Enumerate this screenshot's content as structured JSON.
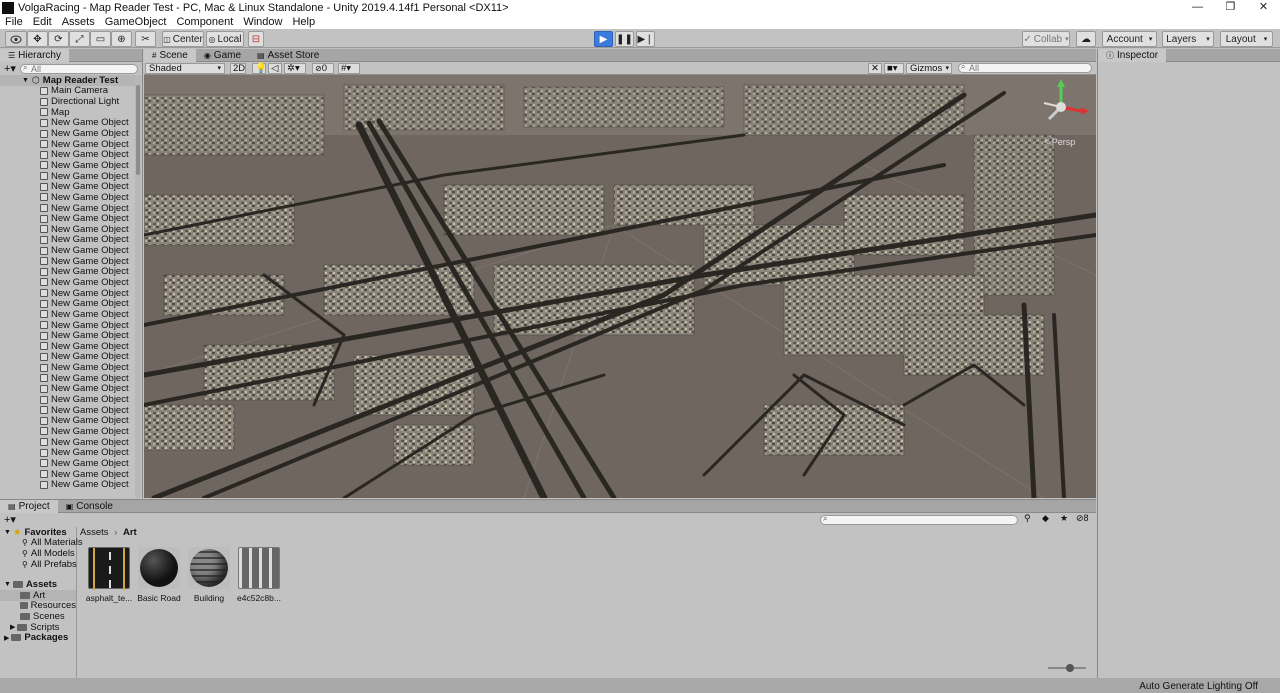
{
  "window": {
    "title": "VolgaRacing - Map Reader Test - PC, Mac & Linux Standalone - Unity 2019.4.14f1 Personal <DX11>",
    "controls": [
      "—",
      "❐",
      "✕"
    ]
  },
  "menu": [
    "File",
    "Edit",
    "Assets",
    "GameObject",
    "Component",
    "Window",
    "Help"
  ],
  "toolbar": {
    "pivot": "Center",
    "space": "Local",
    "collab": "Collab",
    "account": "Account",
    "layers": "Layers",
    "layout": "Layout"
  },
  "hierarchy": {
    "tab": "Hierarchy",
    "search_placeholder": "All",
    "root": "Map Reader Test",
    "items": [
      "Main Camera",
      "Directional Light",
      "Map",
      "New Game Object",
      "New Game Object",
      "New Game Object",
      "New Game Object",
      "New Game Object",
      "New Game Object",
      "New Game Object",
      "New Game Object",
      "New Game Object",
      "New Game Object",
      "New Game Object",
      "New Game Object",
      "New Game Object",
      "New Game Object",
      "New Game Object",
      "New Game Object",
      "New Game Object",
      "New Game Object",
      "New Game Object",
      "New Game Object",
      "New Game Object",
      "New Game Object",
      "New Game Object",
      "New Game Object",
      "New Game Object",
      "New Game Object",
      "New Game Object",
      "New Game Object",
      "New Game Object",
      "New Game Object",
      "New Game Object",
      "New Game Object",
      "New Game Object",
      "New Game Object",
      "New Game Object"
    ]
  },
  "scene": {
    "tabs": [
      "Scene",
      "Game",
      "Asset Store"
    ],
    "draw_mode": "Shaded",
    "mode_2d": "2D",
    "fx_count": "0",
    "gizmos": "Gizmos",
    "search_placeholder": "All",
    "persp_label": "< Persp"
  },
  "inspector": {
    "tab": "Inspector"
  },
  "project": {
    "tabs": [
      "Project",
      "Console"
    ],
    "breadcrumb": [
      "Assets",
      "Art"
    ],
    "favorites": {
      "label": "Favorites",
      "items": [
        "All Materials",
        "All Models",
        "All Prefabs"
      ]
    },
    "assets_tree": {
      "label": "Assets",
      "items": [
        "Art",
        "Resources",
        "Scenes",
        "Scripts"
      ]
    },
    "packages": "Packages",
    "hidden_count": "8",
    "assets": [
      {
        "name": "asphalt_te...",
        "kind": "asphalt"
      },
      {
        "name": "Basic Road",
        "kind": "sphere-dark"
      },
      {
        "name": "Building",
        "kind": "sphere-building"
      },
      {
        "name": "e4c52c8b...",
        "kind": "texture-building"
      }
    ]
  },
  "status": {
    "lighting": "Auto Generate Lighting Off"
  },
  "colors": {
    "play_accent": "#3c7bdc",
    "scene_ground": "#6f6660",
    "road": "#2a2622"
  }
}
